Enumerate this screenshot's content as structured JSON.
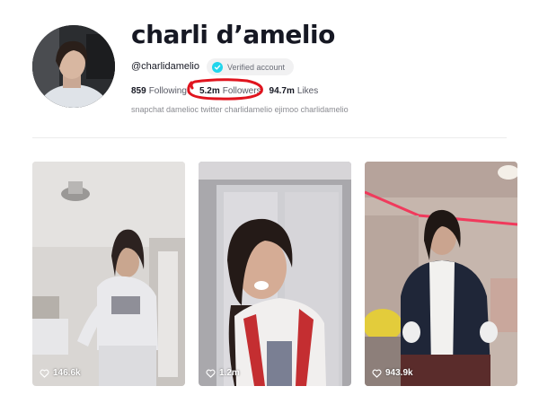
{
  "profile": {
    "name": "charli d’amelio",
    "handle": "@charlidamelio",
    "verified_label": "Verified account",
    "bio": "snapchat damelioc twitter charlidamelio ejimoo charlidamelio"
  },
  "stats": {
    "following_count": "859",
    "following_label": "Following",
    "followers_count": "5.2m",
    "followers_label": "Followers",
    "likes_count": "94.7m",
    "likes_label": "Likes"
  },
  "annotation": {
    "color": "#e0141e"
  },
  "videos": [
    {
      "likes": "146.6k"
    },
    {
      "likes": "1.2m"
    },
    {
      "likes": "943.9k"
    }
  ],
  "colors": {
    "verified_badge": "#20d5ec",
    "text_primary": "#161823",
    "text_secondary": "#8a8b91"
  }
}
